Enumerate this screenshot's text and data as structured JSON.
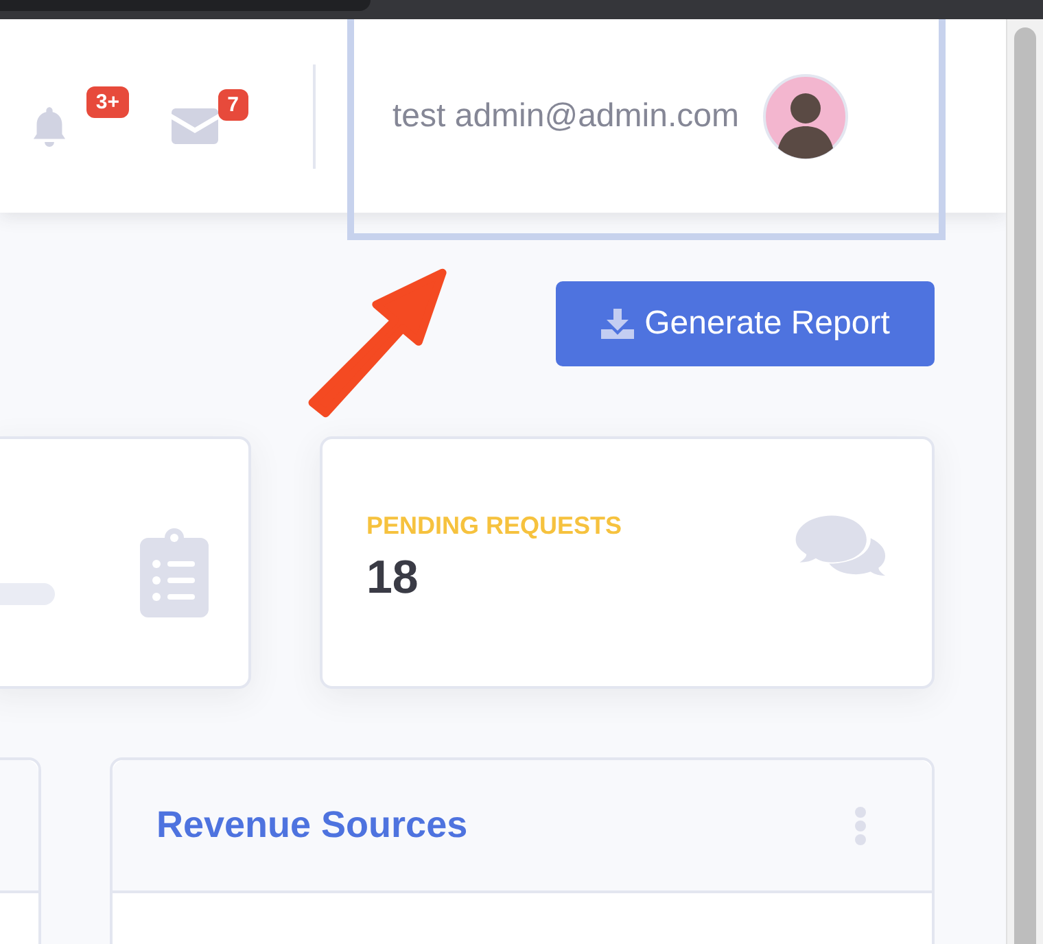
{
  "topbar": {
    "alerts": {
      "badge": "3+"
    },
    "messages": {
      "badge": "7"
    },
    "user": {
      "name": "test admin@admin.com"
    }
  },
  "highlight": {
    "kind": "arrow"
  },
  "actions": {
    "generate_report": "Generate Report"
  },
  "cards": [
    {
      "kind": "progress"
    },
    {
      "kind": "stat",
      "title": "PENDING REQUESTS",
      "value": "18",
      "color": "#f6c23e"
    }
  ],
  "panels": [
    {
      "kind": "blank"
    },
    {
      "kind": "titled",
      "title": "Revenue Sources"
    }
  ]
}
